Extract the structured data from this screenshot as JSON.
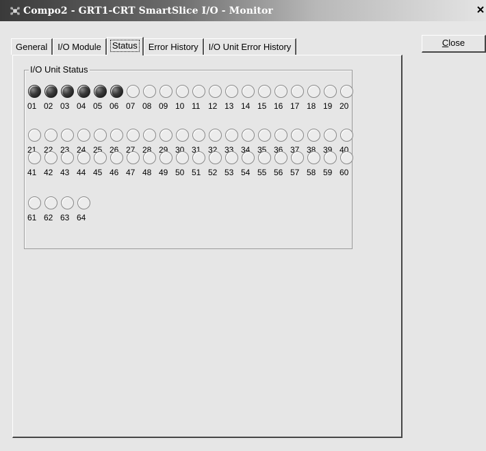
{
  "window": {
    "title": "Compo2 - GRT1-CRT SmartSlice I/O - Monitor",
    "close_glyph": "✕"
  },
  "tabs": [
    {
      "label": "General",
      "active": false
    },
    {
      "label": "I/O Module",
      "active": false
    },
    {
      "label": "Status",
      "active": true
    },
    {
      "label": "Error History",
      "active": false
    },
    {
      "label": "I/O Unit Error History",
      "active": false
    }
  ],
  "close_button": {
    "label_first": "C",
    "label_rest": "lose"
  },
  "io_unit_status": {
    "label": "I/O Unit Status",
    "units": [
      {
        "num": "01",
        "on": true
      },
      {
        "num": "02",
        "on": true
      },
      {
        "num": "03",
        "on": true
      },
      {
        "num": "04",
        "on": true
      },
      {
        "num": "05",
        "on": true
      },
      {
        "num": "06",
        "on": true
      },
      {
        "num": "07",
        "on": false
      },
      {
        "num": "08",
        "on": false
      },
      {
        "num": "09",
        "on": false
      },
      {
        "num": "10",
        "on": false
      },
      {
        "num": "11",
        "on": false
      },
      {
        "num": "12",
        "on": false
      },
      {
        "num": "13",
        "on": false
      },
      {
        "num": "14",
        "on": false
      },
      {
        "num": "15",
        "on": false
      },
      {
        "num": "16",
        "on": false
      },
      {
        "num": "17",
        "on": false
      },
      {
        "num": "18",
        "on": false
      },
      {
        "num": "19",
        "on": false
      },
      {
        "num": "20",
        "on": false
      },
      {
        "num": "21",
        "on": false
      },
      {
        "num": "22",
        "on": false
      },
      {
        "num": "23",
        "on": false
      },
      {
        "num": "24",
        "on": false
      },
      {
        "num": "25",
        "on": false
      },
      {
        "num": "26",
        "on": false
      },
      {
        "num": "27",
        "on": false
      },
      {
        "num": "28",
        "on": false
      },
      {
        "num": "29",
        "on": false
      },
      {
        "num": "30",
        "on": false
      },
      {
        "num": "31",
        "on": false
      },
      {
        "num": "32",
        "on": false
      },
      {
        "num": "33",
        "on": false
      },
      {
        "num": "34",
        "on": false
      },
      {
        "num": "35",
        "on": false
      },
      {
        "num": "36",
        "on": false
      },
      {
        "num": "37",
        "on": false
      },
      {
        "num": "38",
        "on": false
      },
      {
        "num": "39",
        "on": false
      },
      {
        "num": "40",
        "on": false
      },
      {
        "num": "41",
        "on": false
      },
      {
        "num": "42",
        "on": false
      },
      {
        "num": "43",
        "on": false
      },
      {
        "num": "44",
        "on": false
      },
      {
        "num": "45",
        "on": false
      },
      {
        "num": "46",
        "on": false
      },
      {
        "num": "47",
        "on": false
      },
      {
        "num": "48",
        "on": false
      },
      {
        "num": "49",
        "on": false
      },
      {
        "num": "50",
        "on": false
      },
      {
        "num": "51",
        "on": false
      },
      {
        "num": "52",
        "on": false
      },
      {
        "num": "53",
        "on": false
      },
      {
        "num": "54",
        "on": false
      },
      {
        "num": "55",
        "on": false
      },
      {
        "num": "56",
        "on": false
      },
      {
        "num": "57",
        "on": false
      },
      {
        "num": "58",
        "on": false
      },
      {
        "num": "59",
        "on": false
      },
      {
        "num": "60",
        "on": false
      },
      {
        "num": "61",
        "on": false
      },
      {
        "num": "62",
        "on": false
      },
      {
        "num": "63",
        "on": false
      },
      {
        "num": "64",
        "on": false
      }
    ]
  },
  "colors": {
    "led_on": "#2a2a2a",
    "led_off": "#ececec",
    "background": "#e6e6e6"
  }
}
